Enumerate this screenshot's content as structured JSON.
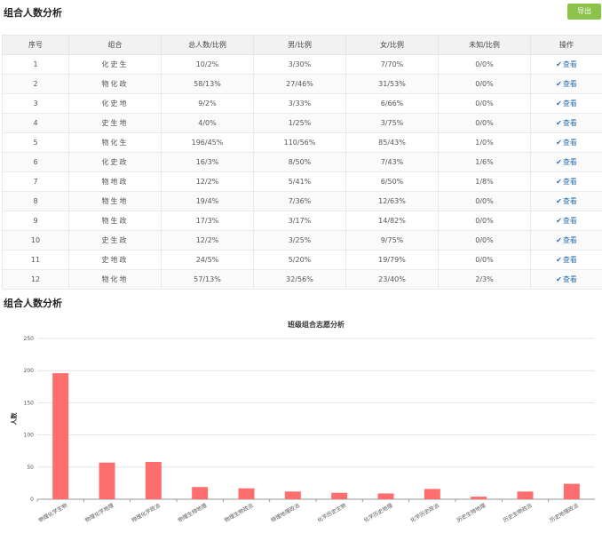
{
  "section1": {
    "title": "组合人数分析"
  },
  "export_label": "导出",
  "table": {
    "headers": [
      "序号",
      "组合",
      "总人数/比例",
      "男/比例",
      "女/比例",
      "未知/比例",
      "操作"
    ],
    "view_label": "查看",
    "rows": [
      [
        "1",
        "化史生",
        "10/2%",
        "3/30%",
        "7/70%",
        "0/0%"
      ],
      [
        "2",
        "物化政",
        "58/13%",
        "27/46%",
        "31/53%",
        "0/0%"
      ],
      [
        "3",
        "化史地",
        "9/2%",
        "3/33%",
        "6/66%",
        "0/0%"
      ],
      [
        "4",
        "史生地",
        "4/0%",
        "1/25%",
        "3/75%",
        "0/0%"
      ],
      [
        "5",
        "物化生",
        "196/45%",
        "110/56%",
        "85/43%",
        "1/0%"
      ],
      [
        "6",
        "化史政",
        "16/3%",
        "8/50%",
        "7/43%",
        "1/6%"
      ],
      [
        "7",
        "物地政",
        "12/2%",
        "5/41%",
        "6/50%",
        "1/8%"
      ],
      [
        "8",
        "物生地",
        "19/4%",
        "7/36%",
        "12/63%",
        "0/0%"
      ],
      [
        "9",
        "物生政",
        "17/3%",
        "3/17%",
        "14/82%",
        "0/0%"
      ],
      [
        "10",
        "史生政",
        "12/2%",
        "3/25%",
        "9/75%",
        "0/0%"
      ],
      [
        "11",
        "史地政",
        "24/5%",
        "5/20%",
        "19/79%",
        "0/0%"
      ],
      [
        "12",
        "物化地",
        "57/13%",
        "32/56%",
        "23/40%",
        "2/3%"
      ]
    ]
  },
  "section2": {
    "title": "组合人数分析"
  },
  "chart_data": {
    "type": "bar",
    "title": "班级组合志愿分析",
    "ylabel": "人数",
    "xlabel": "",
    "ylim": [
      0,
      250
    ],
    "yticks": [
      0,
      50,
      100,
      150,
      200,
      250
    ],
    "grid": true,
    "bar_color": "#ff6e6e",
    "categories": [
      "物理化学生物",
      "物理化学地理",
      "物理化学政治",
      "物理生物地理",
      "物理生物政治",
      "物理地理政治",
      "化学历史生物",
      "化学历史地理",
      "化学历史政治",
      "历史生物地理",
      "历史生物政治",
      "历史地理政治"
    ],
    "values": [
      196,
      57,
      58,
      19,
      17,
      12,
      10,
      9,
      16,
      4,
      12,
      24
    ]
  }
}
